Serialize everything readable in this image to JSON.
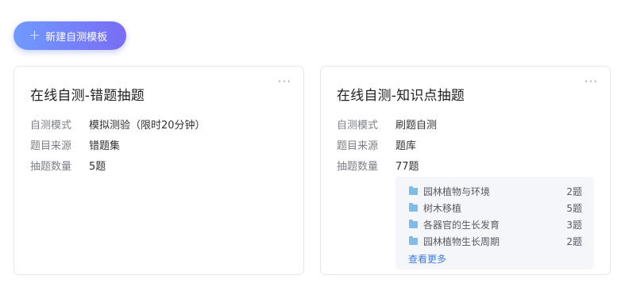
{
  "header": {
    "new_template_label": "新建自测模板",
    "new_template_icon": "plus-icon"
  },
  "cards": [
    {
      "title": "在线自测-错题抽题",
      "more_icon": "ellipsis-icon",
      "rows": [
        {
          "label": "自测模式",
          "value": "模拟测验（限时20分钟）"
        },
        {
          "label": "题目来源",
          "value": "错题集"
        },
        {
          "label": "抽题数量",
          "value": "5题"
        }
      ]
    },
    {
      "title": "在线自测-知识点抽题",
      "more_icon": "ellipsis-icon",
      "rows": [
        {
          "label": "自测模式",
          "value": "刷题自测"
        },
        {
          "label": "题目来源",
          "value": "题库"
        },
        {
          "label": "抽题数量",
          "value": "77题"
        }
      ],
      "knowledge_points": [
        {
          "name": "园林植物与环境",
          "count": "2题"
        },
        {
          "name": "树木移植",
          "count": "5题"
        },
        {
          "name": "各器官的生长发育",
          "count": "3题"
        },
        {
          "name": "园林植物生长周期",
          "count": "2题"
        }
      ],
      "see_more_label": "查看更多"
    }
  ],
  "colors": {
    "button_gradient_start": "#6f9bff",
    "button_gradient_end": "#7a6cf4",
    "link": "#3b7ee8",
    "folder_icon": "#7fbcec"
  }
}
